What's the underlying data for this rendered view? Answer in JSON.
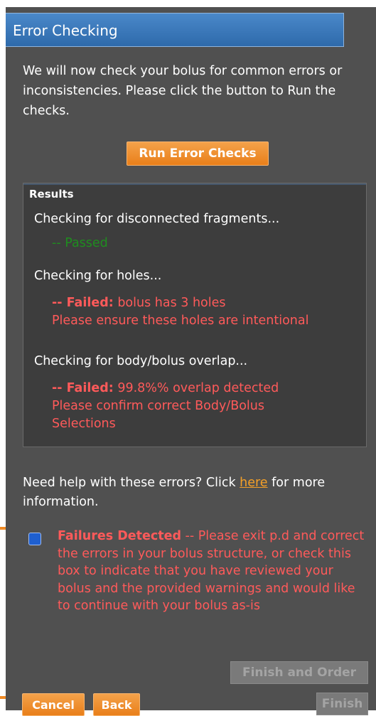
{
  "header": {
    "title": "Error Checking"
  },
  "intro": {
    "text": "We will now check your bolus for common errors or inconsistencies. Please click the button to Run the checks."
  },
  "run_button": {
    "label": "Run Error Checks"
  },
  "results": {
    "title": "Results",
    "checks": [
      {
        "label": "Checking for disconnected fragments...",
        "status": "passed",
        "status_text": "-- Passed"
      },
      {
        "label": "Checking for holes...",
        "status": "failed",
        "failed_prefix": "-- Failed:",
        "message": " bolus has 3 holes",
        "detail": "Please ensure these holes are intentional"
      },
      {
        "label": "Checking for body/bolus overlap...",
        "status": "failed",
        "failed_prefix": "-- Failed:",
        "message": " 99.8%% overlap detected",
        "detail": "Please confirm correct Body/Bolus Selections"
      }
    ]
  },
  "help": {
    "before": "Need help with these errors? Click ",
    "link": "here",
    "after": " for more information."
  },
  "acknowledge": {
    "checked": false,
    "heading": "Failures Detected",
    "text": " -- Please exit p.d and correct the errors in your bolus structure, or check this box to indicate that you have reviewed your bolus and the provided warnings and would like to continue with your bolus as-is"
  },
  "buttons": {
    "finish_and_order": "Finish and Order",
    "cancel": "Cancel",
    "back": "Back",
    "finish": "Finish"
  },
  "colors": {
    "accent": "#e97f1a",
    "failed": "#ff5a5a",
    "passed": "#1f8d1f",
    "panel": "#505050"
  }
}
